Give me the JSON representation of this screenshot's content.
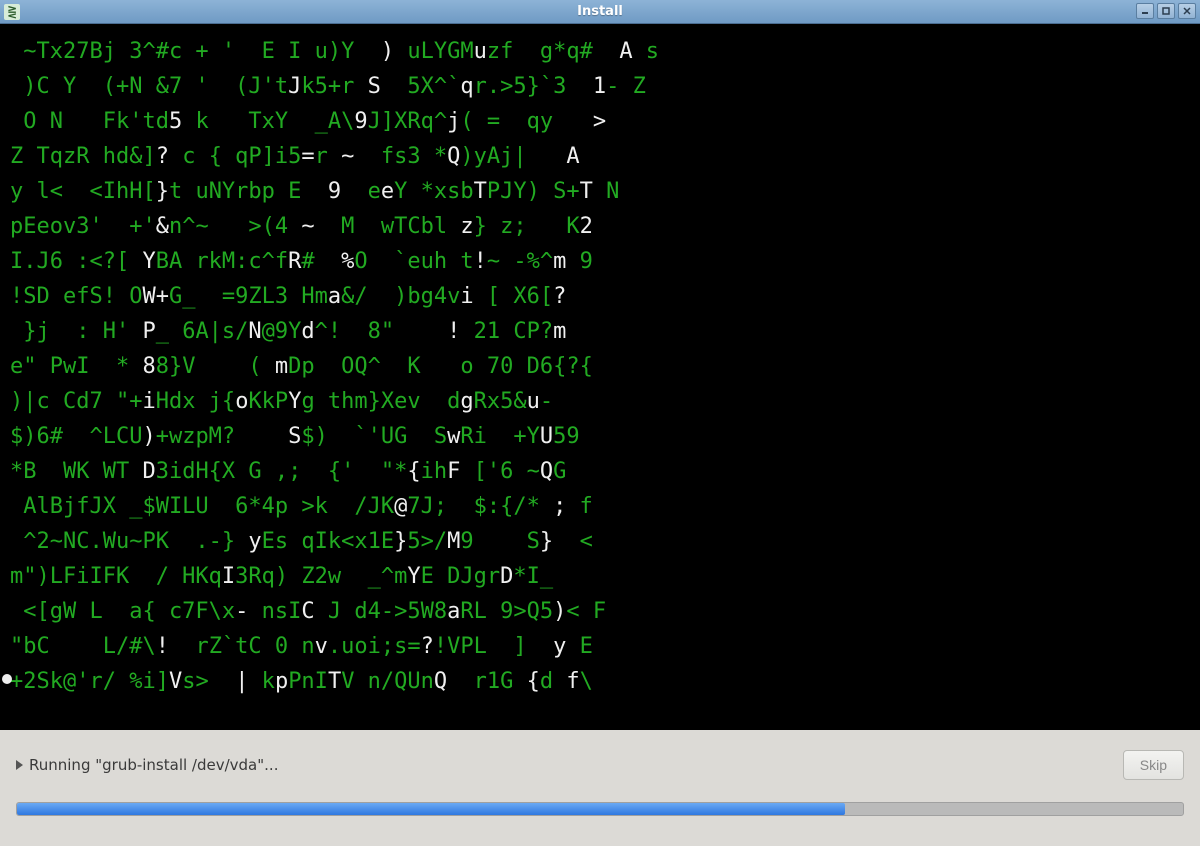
{
  "window": {
    "title": "Install",
    "app_icon_glyph": "⋛"
  },
  "status": {
    "text": "Running \"grub-install /dev/vda\"...",
    "skip_label": "Skip",
    "progress_percent": 71
  },
  "terminal": {
    "rows": [
      [
        [
          " ~Tx27Bj 3^#c + '  E I u)Y  ",
          "g"
        ],
        [
          ")",
          "b"
        ],
        [
          " uLYGM",
          "g"
        ],
        [
          "u",
          "b"
        ],
        [
          "zf  g*q#  ",
          "g"
        ],
        [
          "A",
          "b"
        ],
        [
          " s",
          "g"
        ]
      ],
      [
        [
          " )C Y  (+N &7 '  (J't",
          "g"
        ],
        [
          "J",
          "b"
        ],
        [
          "k5+r ",
          "g"
        ],
        [
          "S",
          "b"
        ],
        [
          "  5X^`",
          "g"
        ],
        [
          "q",
          "b"
        ],
        [
          "r.>5}`3  ",
          "g"
        ],
        [
          "1",
          "b"
        ],
        [
          "- Z",
          "g"
        ]
      ],
      [
        [
          " O N   Fk'td",
          "g"
        ],
        [
          "5",
          "b"
        ],
        [
          " k   TxY  _A\\",
          "g"
        ],
        [
          "9",
          "b"
        ],
        [
          "J]XRq^",
          "g"
        ],
        [
          "j",
          "b"
        ],
        [
          "( =  qy   ",
          "g"
        ],
        [
          ">",
          "b"
        ]
      ],
      [
        [
          "Z TqzR hd&]",
          "g"
        ],
        [
          "?",
          "b"
        ],
        [
          " c { qP]i5",
          "g"
        ],
        [
          "=",
          "b"
        ],
        [
          "r ",
          "g"
        ],
        [
          "~",
          "b"
        ],
        [
          "  fs3 *",
          "g"
        ],
        [
          "Q",
          "b"
        ],
        [
          ")yAj|   ",
          "g"
        ],
        [
          "A",
          "b"
        ]
      ],
      [
        [
          "y l<  <IhH[",
          "g"
        ],
        [
          "}",
          "b"
        ],
        [
          "t uNYrbp E  ",
          "g"
        ],
        [
          "9",
          "b"
        ],
        [
          "  e",
          "g"
        ],
        [
          "e",
          "b"
        ],
        [
          "Y *xsb",
          "g"
        ],
        [
          "T",
          "b"
        ],
        [
          "PJY) S+",
          "g"
        ],
        [
          "T",
          "b"
        ],
        [
          " N",
          "g"
        ]
      ],
      [
        [
          "pEeov3'  +'",
          "g"
        ],
        [
          "&",
          "b"
        ],
        [
          "n^~   >(4 ",
          "g"
        ],
        [
          "~",
          "b"
        ],
        [
          "  M  wTCbl ",
          "g"
        ],
        [
          "z",
          "b"
        ],
        [
          "} z;   K",
          "g"
        ],
        [
          "2",
          "b"
        ]
      ],
      [
        [
          "I.J6 :<?[ ",
          "g"
        ],
        [
          "Y",
          "b"
        ],
        [
          "BA rkM:c^f",
          "g"
        ],
        [
          "R",
          "b"
        ],
        [
          "#  ",
          "g"
        ],
        [
          "%",
          "b"
        ],
        [
          "O  `euh t",
          "g"
        ],
        [
          "!",
          "b"
        ],
        [
          "~ -%^",
          "g"
        ],
        [
          "m",
          "b"
        ],
        [
          " 9",
          "g"
        ]
      ],
      [
        [
          "!SD efS! O",
          "g"
        ],
        [
          "W+",
          "b"
        ],
        [
          "G_  =9ZL3 Hm",
          "g"
        ],
        [
          "a",
          "b"
        ],
        [
          "&/  )bg4v",
          "g"
        ],
        [
          "i",
          "b"
        ],
        [
          " [ X6[",
          "g"
        ],
        [
          "?",
          "b"
        ]
      ],
      [
        [
          " }j  : H' ",
          "g"
        ],
        [
          "P",
          "b"
        ],
        [
          "_ 6A|s/",
          "g"
        ],
        [
          "N",
          "b"
        ],
        [
          "@9Y",
          "g"
        ],
        [
          "d",
          "b"
        ],
        [
          "^!  8\"    ",
          "g"
        ],
        [
          "!",
          "b"
        ],
        [
          " 21 CP?",
          "g"
        ],
        [
          "m",
          "b"
        ]
      ],
      [
        [
          "e\" PwI  * ",
          "g"
        ],
        [
          "8",
          "b"
        ],
        [
          "8}V    ( ",
          "g"
        ],
        [
          "m",
          "b"
        ],
        [
          "Dp  OQ^  K   o 70 D6{?{",
          "g"
        ]
      ],
      [
        [
          ")|c Cd7 \"+",
          "g"
        ],
        [
          "i",
          "b"
        ],
        [
          "Hdx j{",
          "g"
        ],
        [
          "o",
          "b"
        ],
        [
          "KkP",
          "g"
        ],
        [
          "Y",
          "b"
        ],
        [
          "g thm}Xev  d",
          "g"
        ],
        [
          "g",
          "b"
        ],
        [
          "Rx5&",
          "g"
        ],
        [
          "u",
          "b"
        ],
        [
          "-",
          "g"
        ]
      ],
      [
        [
          "$)6#  ^LCU",
          "g"
        ],
        [
          ")",
          "b"
        ],
        [
          "+wzpM?    ",
          "g"
        ],
        [
          "S",
          "b"
        ],
        [
          "$)  `'UG  S",
          "g"
        ],
        [
          "w",
          "b"
        ],
        [
          "Ri  +Y",
          "g"
        ],
        [
          "U",
          "b"
        ],
        [
          "59",
          "g"
        ]
      ],
      [
        [
          "*B  WK WT ",
          "g"
        ],
        [
          "D",
          "b"
        ],
        [
          "3idH{X G ,;  {'  \"*",
          "g"
        ],
        [
          "{",
          "b"
        ],
        [
          "ih",
          "g"
        ],
        [
          "F",
          "b"
        ],
        [
          " ['6 ~",
          "g"
        ],
        [
          "Q",
          "b"
        ],
        [
          "G",
          "g"
        ]
      ],
      [
        [
          " AlBjfJX _$WILU  6*4p >k  /JK",
          "g"
        ],
        [
          "@",
          "b"
        ],
        [
          "7J;  $:{/* ",
          "g"
        ],
        [
          ";",
          "b"
        ],
        [
          " f",
          "g"
        ]
      ],
      [
        [
          " ^2~NC.Wu~PK  .-} ",
          "g"
        ],
        [
          "y",
          "b"
        ],
        [
          "Es qIk<x1E",
          "g"
        ],
        [
          "}",
          "b"
        ],
        [
          "5>/",
          "g"
        ],
        [
          "M",
          "b"
        ],
        [
          "9    S",
          "g"
        ],
        [
          "}",
          "b"
        ],
        [
          "  <",
          "g"
        ]
      ],
      [
        [
          "m\")LFiIFK  / HKq",
          "g"
        ],
        [
          "I",
          "b"
        ],
        [
          "3Rq) Z2w  _^m",
          "g"
        ],
        [
          "Y",
          "b"
        ],
        [
          "E DJgr",
          "g"
        ],
        [
          "D",
          "b"
        ],
        [
          "*I_",
          "g"
        ]
      ],
      [
        [
          " <[gW L  a{ c7F\\x",
          "g"
        ],
        [
          "-",
          "b"
        ],
        [
          " nsI",
          "g"
        ],
        [
          "C",
          "b"
        ],
        [
          " J d4->5W8",
          "g"
        ],
        [
          "a",
          "b"
        ],
        [
          "RL 9>Q5",
          "g"
        ],
        [
          ")",
          "b"
        ],
        [
          "< F",
          "g"
        ]
      ],
      [
        [
          "\"bC    L/#\\",
          "g"
        ],
        [
          "!",
          "b"
        ],
        [
          "  rZ`tC 0 n",
          "g"
        ],
        [
          "v",
          "b"
        ],
        [
          ".uoi;s=",
          "g"
        ],
        [
          "?",
          "b"
        ],
        [
          "!VPL  ]  ",
          "g"
        ],
        [
          "y",
          "b"
        ],
        [
          " E",
          "g"
        ]
      ],
      [
        [
          "+2Sk@'r/ %i]",
          "g"
        ],
        [
          "V",
          "b"
        ],
        [
          "s>  ",
          "g"
        ],
        [
          "|",
          "b"
        ],
        [
          " k",
          "g"
        ],
        [
          "p",
          "b"
        ],
        [
          "PnI",
          "g"
        ],
        [
          "T",
          "b"
        ],
        [
          "V n/QUn",
          "g"
        ],
        [
          "Q",
          "b"
        ],
        [
          "  r1G ",
          "g"
        ],
        [
          "{",
          "b"
        ],
        [
          "d ",
          "g"
        ],
        [
          "f",
          "b"
        ],
        [
          "\\",
          "g"
        ]
      ]
    ]
  }
}
